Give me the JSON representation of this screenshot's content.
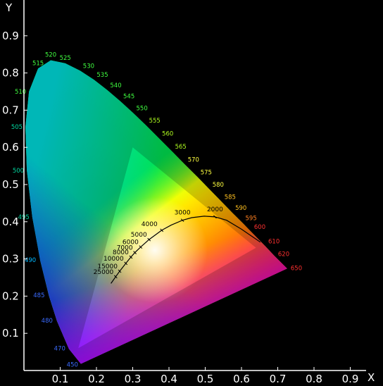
{
  "chart_data": {
    "type": "scatter",
    "xlabel": "X",
    "ylabel": "Y",
    "xlim": [
      0,
      0.8
    ],
    "ylim": [
      0,
      0.9
    ],
    "x_ticks": [
      "0.1",
      "0.2",
      "0.3",
      "0.4",
      "0.5",
      "0.6",
      "0.7",
      "0.8",
      "0.9"
    ],
    "y_ticks": [
      "0.1",
      "0.2",
      "0.3",
      "0.4",
      "0.5",
      "0.6",
      "0.7",
      "0.8",
      "0.9"
    ],
    "spectral_locus": [
      {
        "nm": "450",
        "x": 0.157,
        "y": 0.018
      },
      {
        "nm": "470",
        "x": 0.124,
        "y": 0.058
      },
      {
        "nm": "480",
        "x": 0.091,
        "y": 0.133
      },
      {
        "nm": "485",
        "x": 0.069,
        "y": 0.201
      },
      {
        "nm": "490",
        "x": 0.045,
        "y": 0.295
      },
      {
        "nm": "495",
        "x": 0.023,
        "y": 0.413
      },
      {
        "nm": "500",
        "x": 0.008,
        "y": 0.538
      },
      {
        "nm": "505",
        "x": 0.004,
        "y": 0.655
      },
      {
        "nm": "510",
        "x": 0.014,
        "y": 0.75
      },
      {
        "nm": "515",
        "x": 0.039,
        "y": 0.812
      },
      {
        "nm": "520",
        "x": 0.074,
        "y": 0.834
      },
      {
        "nm": "525",
        "x": 0.114,
        "y": 0.826
      },
      {
        "nm": "530",
        "x": 0.155,
        "y": 0.806
      },
      {
        "nm": "535",
        "x": 0.193,
        "y": 0.782
      },
      {
        "nm": "540",
        "x": 0.23,
        "y": 0.754
      },
      {
        "nm": "545",
        "x": 0.266,
        "y": 0.724
      },
      {
        "nm": "550",
        "x": 0.302,
        "y": 0.692
      },
      {
        "nm": "555",
        "x": 0.337,
        "y": 0.659
      },
      {
        "nm": "560",
        "x": 0.373,
        "y": 0.624
      },
      {
        "nm": "565",
        "x": 0.409,
        "y": 0.589
      },
      {
        "nm": "570",
        "x": 0.444,
        "y": 0.554
      },
      {
        "nm": "575",
        "x": 0.479,
        "y": 0.52
      },
      {
        "nm": "580",
        "x": 0.512,
        "y": 0.487
      },
      {
        "nm": "585",
        "x": 0.545,
        "y": 0.454
      },
      {
        "nm": "590",
        "x": 0.575,
        "y": 0.424
      },
      {
        "nm": "595",
        "x": 0.603,
        "y": 0.397
      },
      {
        "nm": "600",
        "x": 0.627,
        "y": 0.373
      },
      {
        "nm": "610",
        "x": 0.666,
        "y": 0.334
      },
      {
        "nm": "620",
        "x": 0.691,
        "y": 0.308
      },
      {
        "nm": "650",
        "x": 0.726,
        "y": 0.274
      }
    ],
    "gamut_triangle": [
      {
        "x": 0.64,
        "y": 0.33
      },
      {
        "x": 0.3,
        "y": 0.6
      },
      {
        "x": 0.15,
        "y": 0.06
      }
    ],
    "planckian_locus": [
      {
        "cct": "2000",
        "x": 0.527,
        "y": 0.413
      },
      {
        "cct": "3000",
        "x": 0.437,
        "y": 0.404
      },
      {
        "cct": "4000",
        "x": 0.38,
        "y": 0.377
      },
      {
        "cct": "5000",
        "x": 0.345,
        "y": 0.352
      },
      {
        "cct": "6000",
        "x": 0.322,
        "y": 0.332
      },
      {
        "cct": "7000",
        "x": 0.306,
        "y": 0.317
      },
      {
        "cct": "8000",
        "x": 0.295,
        "y": 0.305
      },
      {
        "cct": "10000",
        "x": 0.281,
        "y": 0.288
      },
      {
        "cct": "15000",
        "x": 0.264,
        "y": 0.267
      },
      {
        "cct": "25000",
        "x": 0.253,
        "y": 0.252
      }
    ],
    "planckian_curve": [
      [
        0.652,
        0.345
      ],
      [
        0.6,
        0.38
      ],
      [
        0.559,
        0.404
      ],
      [
        0.527,
        0.413
      ],
      [
        0.497,
        0.415
      ],
      [
        0.463,
        0.411
      ],
      [
        0.437,
        0.404
      ],
      [
        0.406,
        0.391
      ],
      [
        0.38,
        0.377
      ],
      [
        0.345,
        0.352
      ],
      [
        0.322,
        0.332
      ],
      [
        0.306,
        0.317
      ],
      [
        0.295,
        0.305
      ],
      [
        0.281,
        0.288
      ],
      [
        0.264,
        0.267
      ],
      [
        0.253,
        0.252
      ],
      [
        0.24,
        0.234
      ]
    ],
    "colors": {
      "background": "#000000",
      "axes": "#ffffff",
      "locus_curve": "#000000"
    }
  }
}
